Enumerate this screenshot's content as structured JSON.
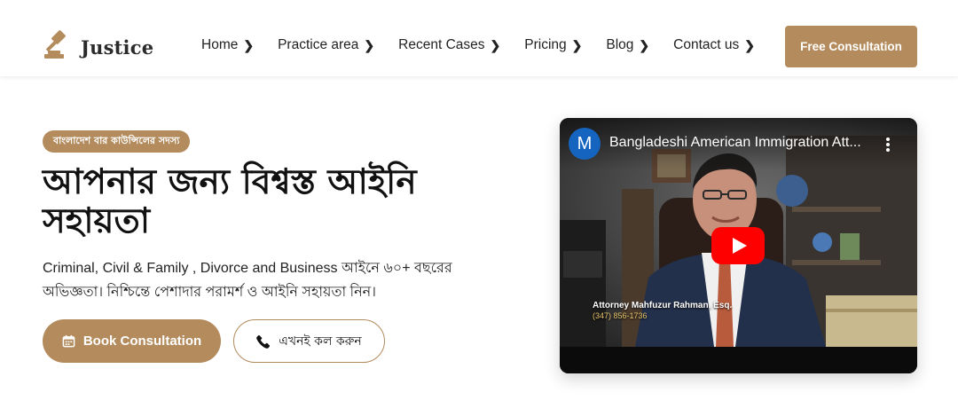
{
  "header": {
    "logo_text": "Justice",
    "nav": [
      {
        "label": "Home"
      },
      {
        "label": "Practice area"
      },
      {
        "label": "Recent Cases"
      },
      {
        "label": "Pricing"
      },
      {
        "label": "Blog"
      },
      {
        "label": "Contact us"
      }
    ],
    "cta_label": "Free Consultation"
  },
  "hero": {
    "badge": "বাংলাদেশ বার কাউন্সিলের সদস্য",
    "headline_line1": "আপনার জন্য বিশ্বস্ত আইনি",
    "headline_line2": "সহায়তা",
    "description_line1": "Criminal, Civil & Family , Divorce and Business আইনে ৬০+ বছরের",
    "description_line2": "অভিজ্ঞতা। নিশ্চিন্তে পেশাদার পরামর্শ ও আইনি সহায়তা নিন।",
    "book_button": "Book Consultation",
    "call_button": "এখনই কল করুন"
  },
  "video": {
    "channel_initial": "M",
    "title": "Bangladeshi American Immigration Att...",
    "lower_third_name": "Attorney Mahfuzur Rahman, Esq.",
    "lower_third_phone": "(347) 856-1736"
  },
  "colors": {
    "accent": "#b38b5d",
    "youtube_red": "#ff0000",
    "channel_blue": "#1565c0"
  },
  "icons": {
    "logo": "gavel-icon",
    "nav_chevron": "chevron-right-icon",
    "book": "calendar-icon",
    "call": "phone-icon",
    "video_play": "youtube-play-icon",
    "video_menu": "more-vertical-icon"
  }
}
